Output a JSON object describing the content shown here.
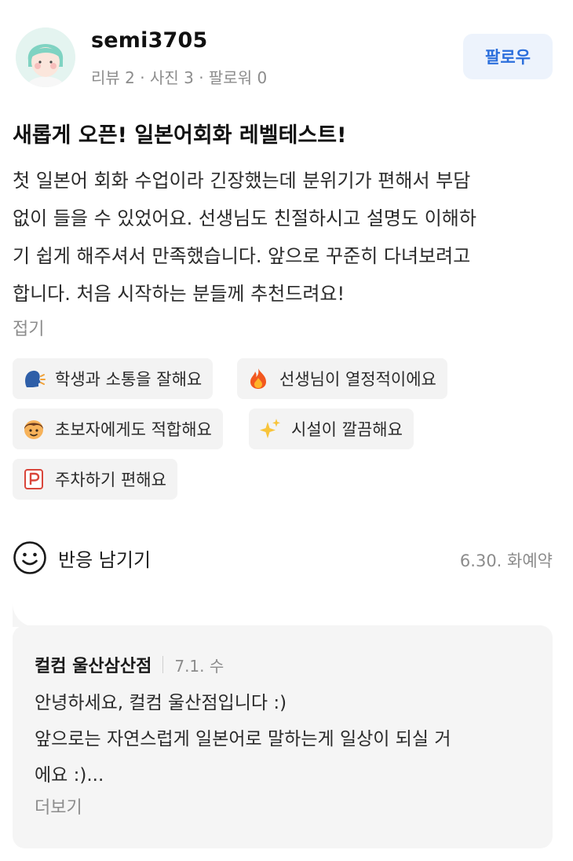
{
  "profile": {
    "username": "semi3705",
    "stats": "리뷰 2 · 사진 3 · 팔로워 0",
    "follow_label": "팔로우"
  },
  "review": {
    "title": "새롭게 오픈! 일본어회화 레벨테스트!",
    "text": "첫 일본어 회화 수업이라 긴장했는데 분위기가 편해서 부담\n없이 들을 수 있었어요. 선생님도 친절하시고 설명도 이해하\n기 쉽게 해주셔서 만족했습니다. 앞으로 꾸준히 다녀보려고\n합니다. 처음 시작하는 분들께 추천드려요!",
    "collapse_label": "접기"
  },
  "keywords": [
    {
      "label": "학생과 소통을 잘해요",
      "icon": "talking-face-icon"
    },
    {
      "label": "선생님이 열정적이에요",
      "icon": "fire-icon"
    },
    {
      "label": "초보자에게도 적합해요",
      "icon": "boy-face-icon"
    },
    {
      "label": "시설이 깔끔해요",
      "icon": "sparkles-icon"
    },
    {
      "label": "주차하기 편해요",
      "icon": "parking-icon"
    }
  ],
  "reaction": {
    "label": "반응 남기기",
    "icon": "smiley-icon",
    "visit_info": "6.30. 화예약"
  },
  "reply": {
    "name": "컬컴 울산삼산점",
    "date": "7.1. 수",
    "text": "안녕하세요, 컬컴 울산점입니다 :)\n앞으로는 자연스럽게 일본어로 말하는게 일상이 되실 거\n에요 :)...",
    "more_label": "더보기"
  },
  "colors": {
    "accent": "#2b6fdc",
    "follow_bg": "#edf3fc",
    "chip_bg": "#f3f3f3",
    "reply_bg": "#f5f5f5",
    "muted_text": "#8c8c8c"
  }
}
